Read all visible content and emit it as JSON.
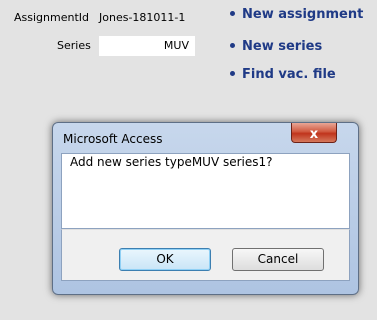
{
  "form": {
    "assignment_label": "AssignmentId",
    "assignment_value": "Jones-181011-1",
    "series_label": "Series",
    "series_value": "MUV"
  },
  "links": {
    "new_assignment": "New assignment",
    "new_series": "New series",
    "find_vac_file": "Find vac. file"
  },
  "dialog": {
    "title": "Microsoft Access",
    "close_glyph": "x",
    "message": "Add new series typeMUV series1?",
    "ok_label": "OK",
    "cancel_label": "Cancel"
  },
  "colors": {
    "link": "#1f3a86",
    "close_button": "#c9462b",
    "dialog_frame": "#b9cde8"
  }
}
